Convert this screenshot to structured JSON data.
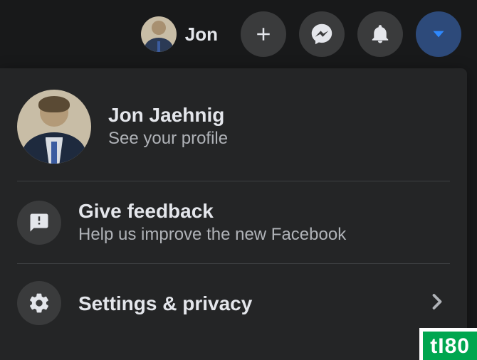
{
  "topbar": {
    "profile_short_name": "Jon",
    "buttons": {
      "create": "create-icon",
      "messenger": "messenger-icon",
      "notifications": "bell-icon",
      "account": "caret-down-icon"
    }
  },
  "dropdown": {
    "profile": {
      "name": "Jon Jaehnig",
      "subtitle": "See your profile"
    },
    "feedback": {
      "title": "Give feedback",
      "subtitle": "Help us improve the new Facebook"
    },
    "settings": {
      "title": "Settings & privacy"
    }
  },
  "watermark": "tI80"
}
